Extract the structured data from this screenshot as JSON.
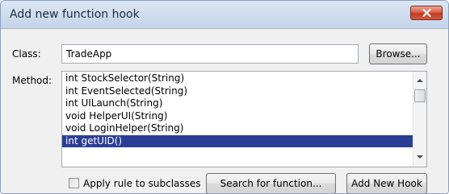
{
  "window": {
    "title": "Add new function hook"
  },
  "class_row": {
    "label": "Class:",
    "value": "TradeApp",
    "browse_label": "Browse..."
  },
  "method_row": {
    "label": "Method:",
    "items": [
      "int StockSelector(String)",
      "int EventSelected(String)",
      "int UILaunch(String)",
      "void HelperUI(String)",
      "void LoginHelper(String)",
      "int getUID()"
    ],
    "selected_index": 5
  },
  "footer": {
    "checkbox_label": "Apply rule to subclasses",
    "checkbox_checked": false,
    "search_label": "Search for function...",
    "add_label": "Add New Hook"
  },
  "colors": {
    "selection": "#2b3e96",
    "close_button": "#c53a22"
  }
}
